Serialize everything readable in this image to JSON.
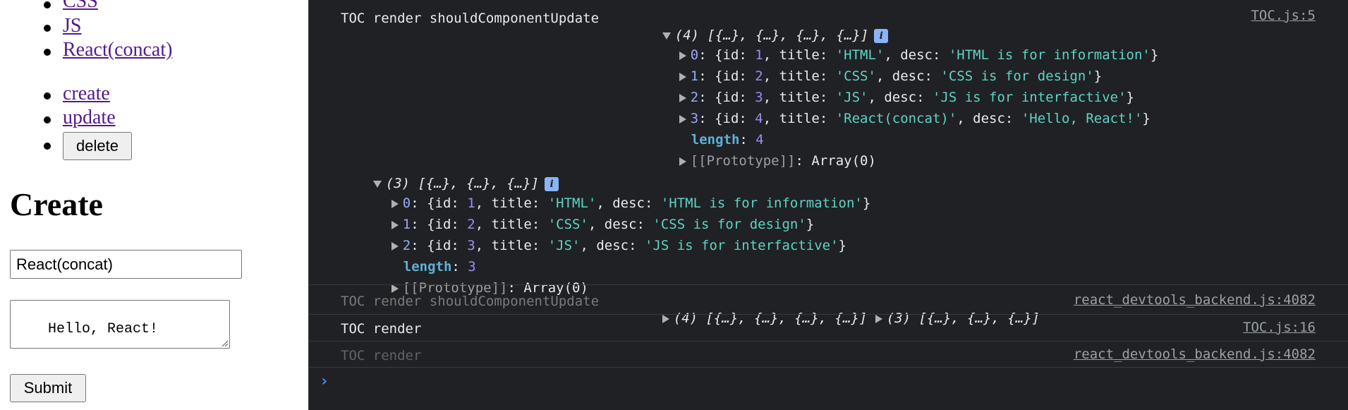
{
  "page": {
    "toc_links": [
      "CSS",
      "JS",
      "React(concat)"
    ],
    "control_links": [
      "create",
      "update"
    ],
    "delete_label": "delete",
    "create_heading": "Create",
    "title_value": "React(concat)",
    "desc_value": "Hello, React!",
    "submit_label": "Submit"
  },
  "console": {
    "entry1": {
      "message": "TOC render shouldComponentUpdate",
      "array_summary": "(4) [{…}, {…}, {…}, {…}]",
      "source": "TOC.js:5",
      "items": [
        {
          "index": "0",
          "id": "1",
          "title": "'HTML'",
          "desc": "'HTML is for information'"
        },
        {
          "index": "1",
          "id": "2",
          "title": "'CSS'",
          "desc": "'CSS is for design'"
        },
        {
          "index": "2",
          "id": "3",
          "title": "'JS'",
          "desc": "'JS is for interfactive'"
        },
        {
          "index": "3",
          "id": "4",
          "title": "'React(concat)'",
          "desc": "'Hello, React!'"
        }
      ],
      "length_label": "length",
      "length_value": "4",
      "prototype_label": "[[Prototype]]",
      "prototype_value": "Array(0)"
    },
    "entry1b": {
      "array_summary": "(3) [{…}, {…}, {…}]",
      "items": [
        {
          "index": "0",
          "id": "1",
          "title": "'HTML'",
          "desc": "'HTML is for information'"
        },
        {
          "index": "1",
          "id": "2",
          "title": "'CSS'",
          "desc": "'CSS is for design'"
        },
        {
          "index": "2",
          "id": "3",
          "title": "'JS'",
          "desc": "'JS is for interfactive'"
        }
      ],
      "length_label": "length",
      "length_value": "3",
      "prototype_label": "[[Prototype]]",
      "prototype_value": "Array(0)"
    },
    "entry2": {
      "message": "TOC render shouldComponentUpdate",
      "array_summary_a": "(4) [{…}, {…}, {…}, {…}]",
      "array_summary_b": "(3) [{…}, {…}, {…}]",
      "source": "react_devtools_backend.js:4082"
    },
    "entry3": {
      "message": "TOC render",
      "source": "TOC.js:16"
    },
    "entry4": {
      "message": "TOC render",
      "source": "react_devtools_backend.js:4082"
    },
    "prompt_symbol": "›",
    "info_glyph": "i",
    "colors": {
      "background": "#202124",
      "string": "#5cd5c5",
      "number": "#9b8cf6",
      "key": "#9aa9f5"
    }
  }
}
